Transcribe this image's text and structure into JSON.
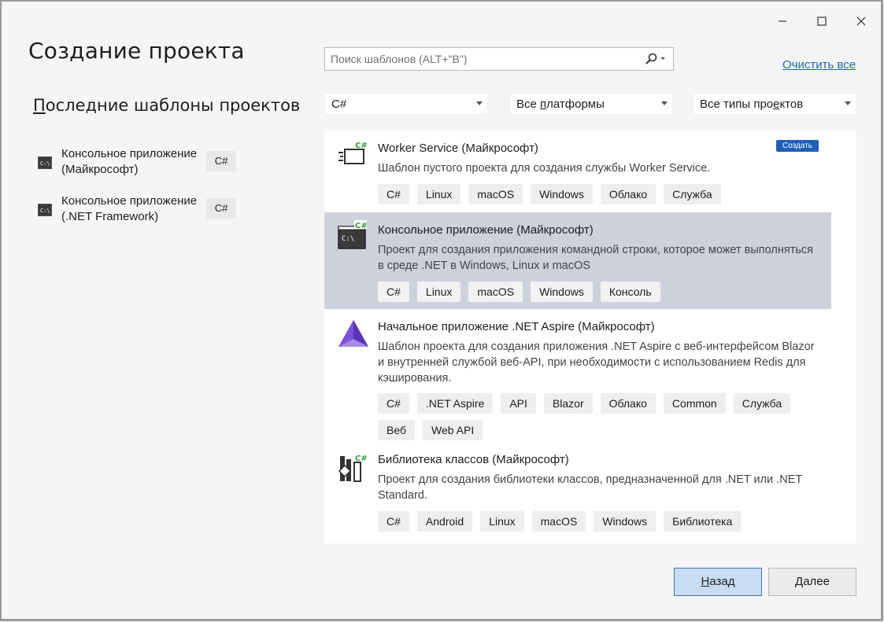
{
  "window": {
    "title": "Создание проекта",
    "controls": {
      "minimize": "minimize-icon",
      "maximize": "maximize-icon",
      "close": "close-icon"
    }
  },
  "recent": {
    "title_first_letter": "П",
    "title_rest": "оследние шаблоны проектов",
    "items": [
      {
        "name": "Консольное приложение (Майкрософт)",
        "lang": "C#"
      },
      {
        "name": "Консольное приложение (.NET Framework)",
        "lang": "C#"
      }
    ]
  },
  "search": {
    "placeholder": "Поиск шаблонов (ALT+\"В\")",
    "clear_all": "Очистить все"
  },
  "filters": {
    "language": "C#",
    "platform_prefix": "Все ",
    "platform_underlined": "п",
    "platform_rest": "латформы",
    "type_prefix": "Все типы про",
    "type_underlined": "е",
    "type_rest": "ктов"
  },
  "templates": [
    {
      "name": "Worker Service (Майкрософт)",
      "description": "Шаблон пустого проекта для создания службы Worker Service.",
      "badge": "Создать",
      "tags": [
        "C#",
        "Linux",
        "macOS",
        "Windows",
        "Облако",
        "Служба"
      ]
    },
    {
      "name": "Консольное приложение (Майкрософт)",
      "description": "Проект для создания приложения командной строки, которое может выполняться в среде .NET в Windows, Linux и macOS",
      "tags": [
        "C#",
        "Linux",
        "macOS",
        "Windows",
        "Консоль"
      ]
    },
    {
      "name": "Начальное приложение .NET Aspire (Майкрософт)",
      "description": "Шаблон проекта для создания приложения .NET Aspire с веб-интерфейсом Blazor и внутренней службой веб-API, при необходимости с использованием Redis для кэширования.",
      "tags": [
        "C#",
        ".NET Aspire",
        "API",
        "Blazor",
        "Облако",
        "Common",
        "Служба",
        "Веб",
        "Web API"
      ]
    },
    {
      "name": "Библиотека классов (Майкрософт)",
      "description": "Проект для создания библиотеки классов, предназначенной для .NET или .NET Standard.",
      "tags": [
        "C#",
        "Android",
        "Linux",
        "macOS",
        "Windows",
        "Библиотека"
      ]
    }
  ],
  "buttons": {
    "back_first": "Н",
    "back_rest": "азад",
    "next_first": "Д",
    "next_rest": "алее"
  },
  "colors": {
    "accent": "#1f5fb8",
    "selected_row": "#ced0dc",
    "link": "#1a63c9",
    "csharp_badge": "#3c9a3c"
  }
}
